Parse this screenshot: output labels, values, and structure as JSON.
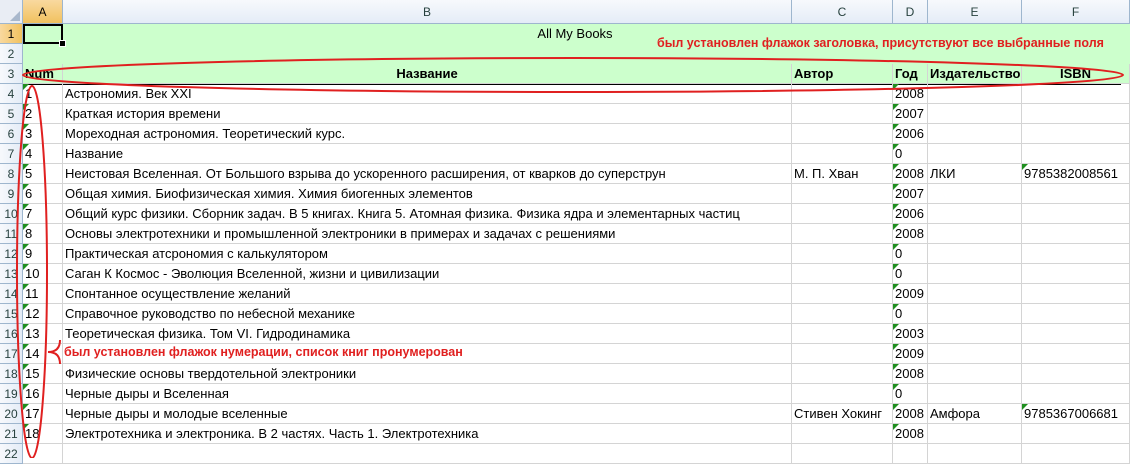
{
  "columns": [
    "A",
    "B",
    "C",
    "D",
    "E",
    "F"
  ],
  "rows": [
    "1",
    "2",
    "3",
    "4",
    "5",
    "6",
    "7",
    "8",
    "9",
    "10",
    "11",
    "12",
    "13",
    "14",
    "15",
    "16",
    "17",
    "18",
    "19",
    "20",
    "21",
    "22"
  ],
  "title": "All My Books",
  "headers": {
    "num": "Num",
    "name": "Название",
    "author": "Автор",
    "year": "Год",
    "publisher": "Издательство",
    "isbn": "ISBN"
  },
  "books": [
    {
      "num": "1",
      "name": "Астрономия. Век XXI",
      "author": "",
      "year": "2008",
      "publisher": "",
      "isbn": ""
    },
    {
      "num": "2",
      "name": "Краткая история времени",
      "author": "",
      "year": "2007",
      "publisher": "",
      "isbn": ""
    },
    {
      "num": "3",
      "name": "Мореходная астрономия. Теоретический курс.",
      "author": "",
      "year": "2006",
      "publisher": "",
      "isbn": ""
    },
    {
      "num": "4",
      "name": "Название",
      "author": "",
      "year": "0",
      "publisher": "",
      "isbn": ""
    },
    {
      "num": "5",
      "name": "Неистовая Вселенная. От Большого взрыва до ускоренного расширения, от кварков до суперструн",
      "author": "М. П. Хван",
      "year": "2008",
      "publisher": "ЛКИ",
      "isbn": "9785382008561"
    },
    {
      "num": "6",
      "name": "Общая химия. Биофизическая химия. Химия биогенных элементов",
      "author": "",
      "year": "2007",
      "publisher": "",
      "isbn": ""
    },
    {
      "num": "7",
      "name": "Общий курс физики. Сборник задач. В 5 книгах.  Книга 5. Атомная физика. Физика ядра и элементарных частиц",
      "author": "",
      "year": "2006",
      "publisher": "",
      "isbn": ""
    },
    {
      "num": "8",
      "name": "Основы электротехники и промышленной электроники в примерах и задачах с решениями",
      "author": "",
      "year": "2008",
      "publisher": "",
      "isbn": ""
    },
    {
      "num": "9",
      "name": "Практическая атсрономия с калькулятором",
      "author": "",
      "year": "0",
      "publisher": "",
      "isbn": ""
    },
    {
      "num": "10",
      "name": "Саган К Космос - Эволюция Вселенной, жизни и цивилизации",
      "author": "",
      "year": "0",
      "publisher": "",
      "isbn": ""
    },
    {
      "num": "11",
      "name": "Спонтанное осуществление желаний",
      "author": "",
      "year": "2009",
      "publisher": "",
      "isbn": ""
    },
    {
      "num": "12",
      "name": "Справочное руководство по небесной механике",
      "author": "",
      "year": "0",
      "publisher": "",
      "isbn": ""
    },
    {
      "num": "13",
      "name": "Теоретическая физика. Том VI. Гидродинамика",
      "author": "",
      "year": "2003",
      "publisher": "",
      "isbn": ""
    },
    {
      "num": "14",
      "name": "",
      "author": "",
      "year": "2009",
      "publisher": "",
      "isbn": ""
    },
    {
      "num": "15",
      "name": "Физические основы твердотельной электроники",
      "author": "",
      "year": "2008",
      "publisher": "",
      "isbn": ""
    },
    {
      "num": "16",
      "name": "Черные дыры и Вселенная",
      "author": "",
      "year": "0",
      "publisher": "",
      "isbn": ""
    },
    {
      "num": "17",
      "name": "Черные дыры и молодые вселенные",
      "author": "Стивен Хокинг",
      "year": "2008",
      "publisher": "Амфора",
      "isbn": "9785367006681"
    },
    {
      "num": "18",
      "name": "Электротехника и электроника. В 2 частях. Часть 1. Электротехника",
      "author": "",
      "year": "2008",
      "publisher": "",
      "isbn": ""
    }
  ],
  "annotations": {
    "header_note": "был установлен флажок заголовка, присутствуют все выбранные поля",
    "numbering_note": "был установлен флажок нумерации, список книг пронумерован"
  },
  "colors": {
    "green_fill": "#ccffcc",
    "annotation": "#e02020",
    "selected_header": "#f1c15f"
  }
}
